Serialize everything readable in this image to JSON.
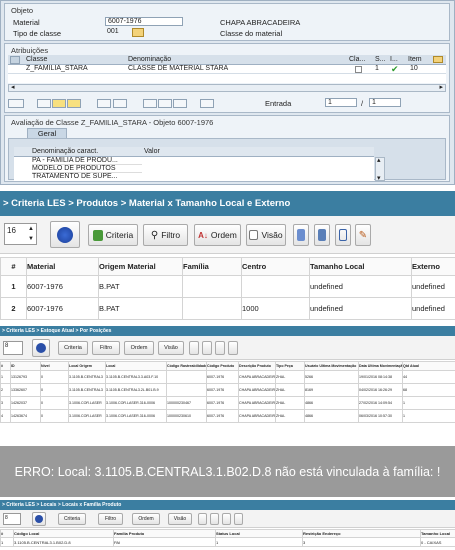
{
  "sap": {
    "objeto": {
      "title": "Objeto",
      "material_label": "Material",
      "material_value": "6007-1976",
      "material_desc": "CHAPA ABRACADEIRA",
      "tipo_label": "Tipo de classe",
      "tipo_value": "001",
      "tipo_desc": "Classe do material"
    },
    "atribuicoes": {
      "title": "Atribuições",
      "columns": [
        "Classe",
        "Denominação",
        "Cla...",
        "S...",
        "I...",
        "Item"
      ],
      "row": {
        "classe": "Z_FAMILIA_STARA",
        "denominacao": "CLASSE DE MATERIAL STARA",
        "status": "1",
        "item": "10"
      },
      "entrada_label": "Entrada",
      "entrada_value": "1",
      "entrada_sep": "/",
      "entrada_total": "1"
    },
    "avaliacao": {
      "title": "Avaliação de Classe Z_FAMILIA_STARA - Objeto 6007-1976",
      "tab": "Geral",
      "columns": [
        "Denominação caract.",
        "Valor"
      ],
      "rows": [
        "PA - FAMILIA DE PRODU...",
        "MODELO DE PRODUTOS",
        "TRATAMENTO DE SUPE..."
      ]
    }
  },
  "les1": {
    "breadcrumb": "> Criteria LES > Produtos > Material x Tamanho Local e Externo",
    "page_size": "16",
    "buttons": {
      "criteria": "Criteria",
      "filtro": "Filtro",
      "ordem": "Ordem",
      "visao": "Visão"
    },
    "columns": [
      "#",
      "Material",
      "Origem Material",
      "Família",
      "Centro",
      "Tamanho Local",
      "Externo"
    ],
    "rows": [
      [
        "1",
        "6007-1976",
        "B.PAT",
        "",
        "",
        "undefined",
        "undefined"
      ],
      [
        "2",
        "6007-1976",
        "B.PAT",
        "",
        "1000",
        "undefined",
        "undefined"
      ]
    ]
  },
  "les2": {
    "breadcrumb": "> Criteria LES > Estoque Atual > Por Posições",
    "page_size": "8",
    "buttons": {
      "criteria": "Criteria",
      "filtro": "Filtro",
      "ordem": "Ordem",
      "visao": "Visão"
    },
    "columns": [
      "#",
      "ID",
      "Nível",
      "Local Origem",
      "Local",
      "Código Rastreabilidade",
      "Código Produto",
      "Descrição Produto",
      "Tipo Peça",
      "Usuário Ultima Movimentação",
      "Data Ultima Movimentação",
      "Qtd Atual"
    ],
    "rows": [
      [
        "1",
        "13126793",
        "0",
        "3.1105.B.CENTRAL3",
        "3.1105.B.CENTRAL3.3.A03.F.10",
        "",
        "6007-1976",
        "CHAPA ABRACADEIRA",
        "ZHAL",
        "5266",
        "19/01/2016 08:14:38",
        "44"
      ],
      [
        "2",
        "13362607",
        "0",
        "3.1105.B.CENTRAL3",
        "3.1105.B.CENTRAL3.2L.B01.B.9",
        "",
        "6007-1976",
        "CHAPA ABRACADEIRA",
        "ZHAL",
        "8169",
        "04/02/2016 16:26:29",
        "68"
      ],
      [
        "3",
        "14262037",
        "0",
        "3.1006.COR.LASER",
        "3.1006.COR.LASER.316-0006",
        "100000230467",
        "6007-1976",
        "CHAPA ABRACADEIRA",
        "ZHAL",
        "4866",
        "27/02/2016 14:09:54",
        "1"
      ],
      [
        "4",
        "14263674",
        "0",
        "3.1006.COR.LASER",
        "3.1006.COR.LASER.316-0006",
        "100000230610",
        "6007-1976",
        "CHAPA ABRACADEIRA",
        "ZHAL",
        "4866",
        "06/03/2016 10:57:30",
        "1"
      ]
    ]
  },
  "error": {
    "message": "ERRO: Local: 3.1105.B.CENTRAL3.1.B02.D.8 não está vinculada à família: !"
  },
  "les3": {
    "breadcrumb": "> Criteria LES > Locais > Locais x Família Produto",
    "page_size": "8",
    "buttons": {
      "criteria": "Criteria",
      "filtro": "Filtro",
      "ordem": "Ordem",
      "visao": "Visão"
    },
    "columns": [
      "#",
      "Código Local",
      "Família Produto",
      "Status Local",
      "Restrição Endereço",
      "Tamanho Local"
    ],
    "rows": [
      [
        "1",
        "3.1105.B.CENTRAL3.1.B02.D.8",
        "PAI",
        "1",
        "3",
        "0 - CAIXAS"
      ]
    ]
  }
}
